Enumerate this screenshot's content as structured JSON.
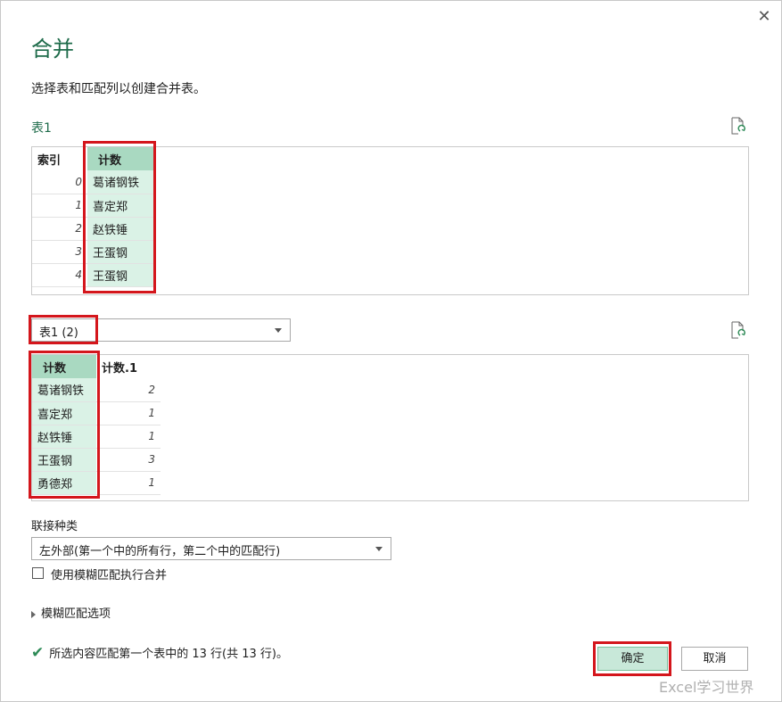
{
  "dialog": {
    "title": "合并",
    "subtitle": "选择表和匹配列以创建合并表。",
    "close_label": "✕"
  },
  "table1": {
    "label": "表1",
    "columns": [
      "索引",
      "计数"
    ],
    "rows": [
      {
        "index": "0",
        "name": "葛诸钢铁"
      },
      {
        "index": "1",
        "name": "喜定郑"
      },
      {
        "index": "2",
        "name": "赵铁锤"
      },
      {
        "index": "3",
        "name": "王蛋钢"
      },
      {
        "index": "4",
        "name": "王蛋钢"
      }
    ]
  },
  "table2": {
    "selected": "表1 (2)",
    "columns": [
      "计数",
      "计数.1"
    ],
    "rows": [
      {
        "name": "葛诸钢铁",
        "count": "2"
      },
      {
        "name": "喜定郑",
        "count": "1"
      },
      {
        "name": "赵铁锤",
        "count": "1"
      },
      {
        "name": "王蛋钢",
        "count": "3"
      },
      {
        "name": "勇德郑",
        "count": "1"
      }
    ]
  },
  "join": {
    "label": "联接种类",
    "selected": "左外部(第一个中的所有行，第二个中的匹配行)"
  },
  "fuzzy": {
    "checkbox_label": "使用模糊匹配执行合并",
    "checked": false,
    "options_label": "模糊匹配选项"
  },
  "status": {
    "text": "所选内容匹配第一个表中的 13 行(共 13 行)。"
  },
  "buttons": {
    "ok": "确定",
    "cancel": "取消"
  },
  "watermark": "Excel学习世界",
  "colors": {
    "accent": "#1e6b4a",
    "highlight_border": "#d4161c",
    "selected_column": "#daf2e6",
    "selected_header": "#a9d9c1"
  }
}
